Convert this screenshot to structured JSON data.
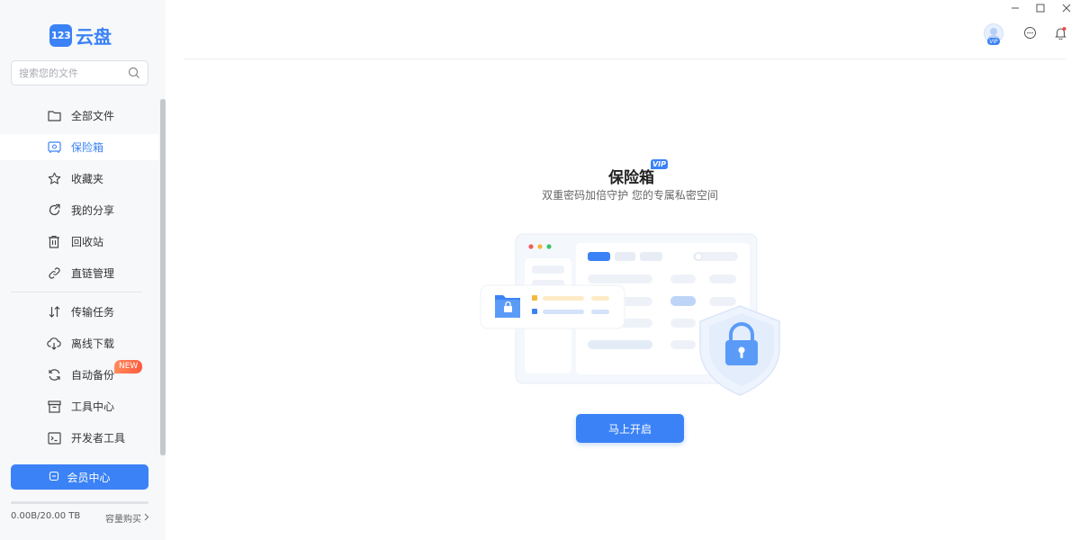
{
  "app": {
    "logo_badge": "123",
    "logo_text": "云盘"
  },
  "search": {
    "placeholder": "搜索您的文件"
  },
  "sidebar": {
    "items": [
      {
        "label": "全部文件",
        "icon": "folder-icon"
      },
      {
        "label": "保险箱",
        "icon": "safe-icon",
        "active": true
      },
      {
        "label": "收藏夹",
        "icon": "star-icon"
      },
      {
        "label": "我的分享",
        "icon": "share-icon"
      },
      {
        "label": "回收站",
        "icon": "trash-icon"
      },
      {
        "label": "直链管理",
        "icon": "link-icon"
      }
    ],
    "tools": [
      {
        "label": "传输任务",
        "icon": "transfer-icon"
      },
      {
        "label": "离线下载",
        "icon": "cloud-download-icon"
      },
      {
        "label": "自动备份",
        "icon": "sync-icon",
        "badge": "NEW"
      },
      {
        "label": "工具中心",
        "icon": "toolbox-icon"
      },
      {
        "label": "开发者工具",
        "icon": "terminal-icon"
      }
    ],
    "vip_button": "会员中心",
    "storage": {
      "used_text": "0.00B/20.00 TB",
      "used_fraction": 0,
      "buy_label": "容量购买"
    }
  },
  "topbar": {
    "avatar_badge": "VIP"
  },
  "main": {
    "title": "保险箱",
    "title_badge": "VIP",
    "subtitle": "双重密码加倍守护 您的专属私密空间",
    "start_button": "马上开启"
  },
  "colors": {
    "accent": "#3b82f6",
    "sidebar_bg": "#f7f8fa",
    "new_badge": "#ff6a45"
  }
}
